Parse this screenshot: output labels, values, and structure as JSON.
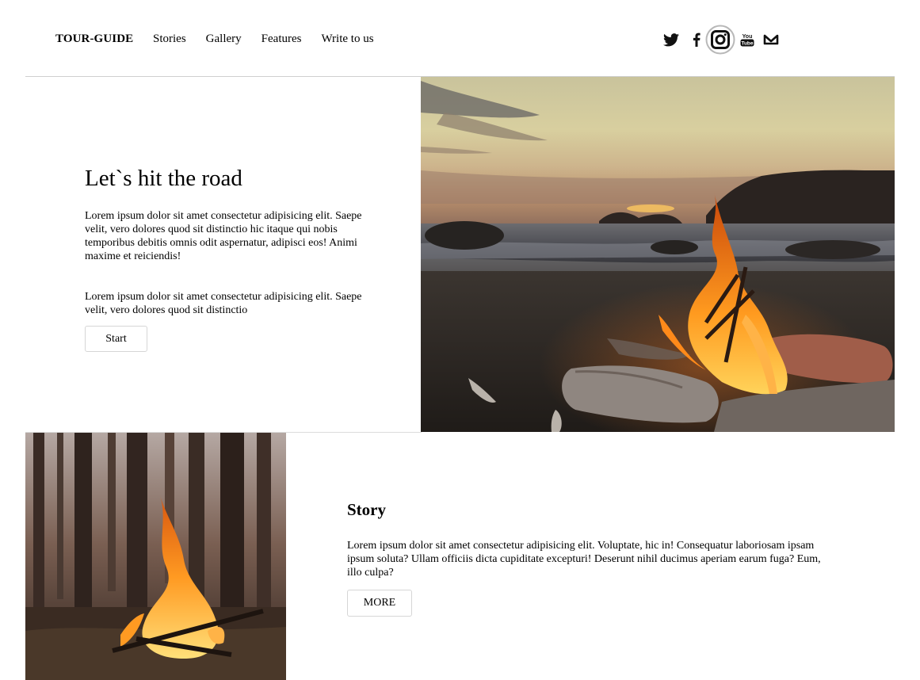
{
  "header": {
    "logo": "TOUR-GUIDE",
    "nav": [
      "Stories",
      "Gallery",
      "Features",
      "Write to us"
    ],
    "social_icons": [
      "twitter-icon",
      "facebook-icon",
      "instagram-icon",
      "youtube-icon",
      "mail-icon"
    ]
  },
  "hero": {
    "title": "Let`s hit the road",
    "paragraph1": "Lorem ipsum dolor sit amet consectetur adipisicing elit. Saepe velit, vero dolores quod sit distinctio hic itaque qui nobis temporibus debitis omnis odit aspernatur, adipisci eos! Animi maxime et reiciendis!",
    "paragraph2": "Lorem ipsum dolor sit amet consectetur adipisicing elit. Saepe velit, vero dolores quod sit distinctio",
    "button": "Start",
    "image": "beach-bonfire-sunset"
  },
  "story": {
    "title": "Story",
    "paragraph": "Lorem ipsum dolor sit amet consectetur adipisicing elit. Voluptate, hic in! Consequatur laboriosam ipsam ipsum soluta? Ullam officiis dicta cupiditate excepturi! Deserunt nihil ducimus aperiam earum fuga? Eum, illo culpa?",
    "button": "MORE",
    "image": "forest-campfire"
  }
}
